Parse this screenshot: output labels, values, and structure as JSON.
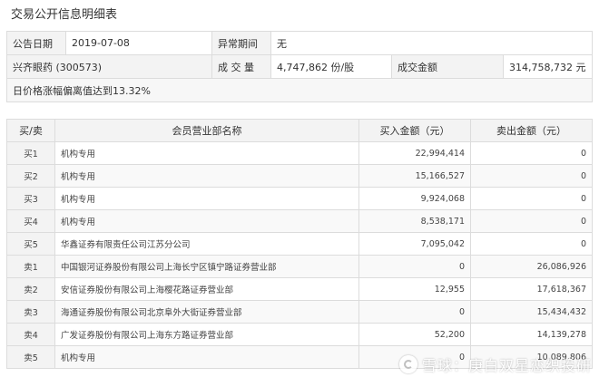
{
  "page_title": "交易公开信息明细表",
  "info": {
    "date_label": "公告日期",
    "date_value": "2019-07-08",
    "period_label": "异常期间",
    "period_value": "无",
    "stock_name": "兴齐眼药 (300573)",
    "volume_label": "成 交 量",
    "volume_value": "4,747,862 份/股",
    "amount_label": "成交金额",
    "amount_value": "314,758,732 元",
    "reason": "日价格涨幅偏离值达到13.32%"
  },
  "detail": {
    "headers": [
      "买/卖",
      "会员营业部名称",
      "买入金额（元）",
      "卖出金额（元）"
    ],
    "rows": [
      {
        "side": "买1",
        "name": "机构专用",
        "buy": "22,994,414",
        "sell": "0"
      },
      {
        "side": "买2",
        "name": "机构专用",
        "buy": "15,166,527",
        "sell": "0"
      },
      {
        "side": "买3",
        "name": "机构专用",
        "buy": "9,924,068",
        "sell": "0"
      },
      {
        "side": "买4",
        "name": "机构专用",
        "buy": "8,538,171",
        "sell": "0"
      },
      {
        "side": "买5",
        "name": "华鑫证券有限责任公司江苏分公司",
        "buy": "7,095,042",
        "sell": "0"
      },
      {
        "side": "卖1",
        "name": "中国银河证券股份有限公司上海长宁区镇宁路证券营业部",
        "buy": "0",
        "sell": "26,086,926"
      },
      {
        "side": "卖2",
        "name": "安信证券股份有限公司上海樱花路证券营业部",
        "buy": "12,955",
        "sell": "17,618,367"
      },
      {
        "side": "卖3",
        "name": "海通证券股份有限公司北京阜外大街证券营业部",
        "buy": "0",
        "sell": "15,434,432"
      },
      {
        "side": "卖4",
        "name": "广发证券股份有限公司上海东方路证券营业部",
        "buy": "52,200",
        "sell": "14,139,278"
      },
      {
        "side": "卖5",
        "name": "机构专用",
        "buy": "0",
        "sell": "10,089,806"
      }
    ]
  },
  "watermark": {
    "text": "雪球：庚白双星恋织投研",
    "icon": "snowball-logo-icon"
  }
}
